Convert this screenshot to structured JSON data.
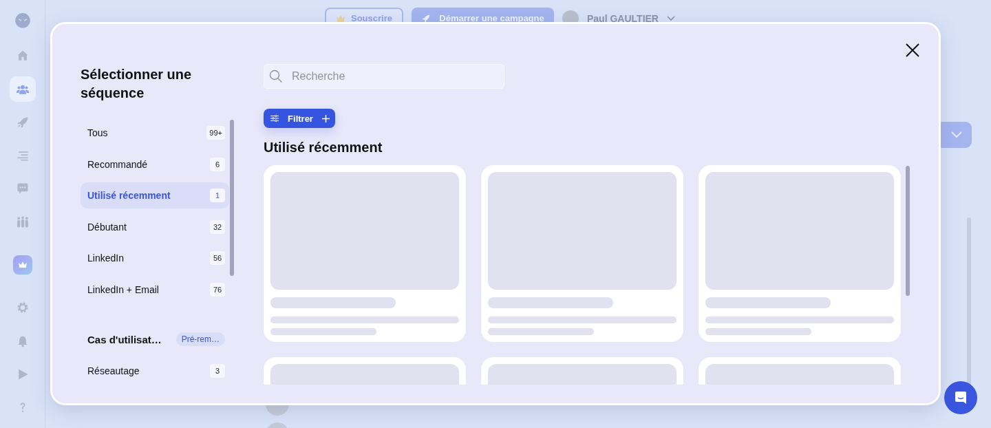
{
  "sidebar": {
    "items": [
      {
        "selected": false
      },
      {
        "selected": true
      },
      {
        "selected": false
      },
      {
        "selected": false
      },
      {
        "selected": false
      },
      {
        "selected": false
      },
      {
        "selected": false
      },
      {
        "selected": false
      },
      {
        "selected": false
      },
      {
        "selected": false
      },
      {
        "selected": false
      }
    ]
  },
  "header": {
    "subscribe_button": "Souscrire",
    "campaign_button": "Démarrer une campagne",
    "user_name": "Paul GAULTIER"
  },
  "modal": {
    "title": "Sélectionner une séquence",
    "search": {
      "placeholder": "Recherche"
    },
    "filter_button": "Filtrer",
    "categories": [
      {
        "label": "Tous",
        "count": "99+",
        "selected": false
      },
      {
        "label": "Recommandé",
        "count": "6",
        "selected": false
      },
      {
        "label": "Utilisé récemment",
        "count": "1",
        "selected": true
      },
      {
        "label": "Débutant",
        "count": "32",
        "selected": false
      },
      {
        "label": "LinkedIn",
        "count": "56",
        "selected": false
      },
      {
        "label": "LinkedIn + Email",
        "count": "76",
        "selected": false
      }
    ],
    "section": {
      "title": "Cas d'utilisat…",
      "badge": "Pré-rem…",
      "items": [
        {
          "label": "Réseautage",
          "count": "3",
          "selected": false
        }
      ]
    },
    "heading": "Utilisé récemment",
    "cards": [
      {
        "kind": "skeleton"
      },
      {
        "kind": "skeleton"
      },
      {
        "kind": "skeleton"
      },
      {
        "kind": "skeleton"
      },
      {
        "kind": "skeleton"
      },
      {
        "kind": "skeleton"
      }
    ]
  }
}
